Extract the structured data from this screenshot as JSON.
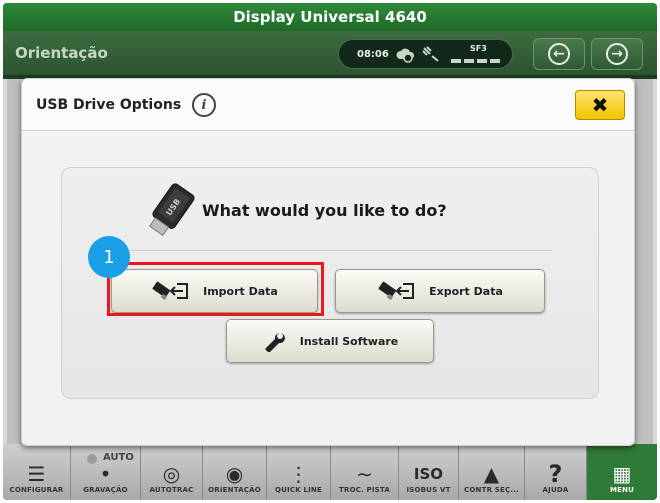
{
  "window": {
    "title": "Display Universal 4640"
  },
  "appbar": {
    "title": "Orientação",
    "status": {
      "time": "08:06",
      "signal_label": "SF3"
    }
  },
  "dialog": {
    "title": "USB Drive Options",
    "question": "What would you like to do?",
    "buttons": {
      "import": "Import Data",
      "export": "Export Data",
      "install": "Install Software"
    }
  },
  "toolbar": {
    "auto_label": "AUTO",
    "items": [
      {
        "label": "CONFIGURAR",
        "icon": "checklist-icon"
      },
      {
        "label": "GRAVAÇÃO",
        "icon": "recording-icon"
      },
      {
        "label": "AUTOTRAC",
        "icon": "steering-icon"
      },
      {
        "label": "ORIENTAÇÃO",
        "icon": "compass-icon"
      },
      {
        "label": "QUICK LINE",
        "icon": "line-icon"
      },
      {
        "label": "TROC. PISTA",
        "icon": "track-shift-icon"
      },
      {
        "label": "ISOBUS VT",
        "icon": "iso-icon"
      },
      {
        "label": "CONTR SEÇ...",
        "icon": "section-control-icon"
      },
      {
        "label": "AJUDA",
        "icon": "help-icon"
      },
      {
        "label": "MENU",
        "icon": "menu-grid-icon"
      }
    ],
    "iso_text": "ISO"
  },
  "annotation": {
    "step": "1"
  },
  "colors": {
    "accent_green": "#2f7a36",
    "close_yellow": "#f2c200",
    "highlight_red": "#e8191b",
    "badge_blue": "#1a9fe6"
  }
}
